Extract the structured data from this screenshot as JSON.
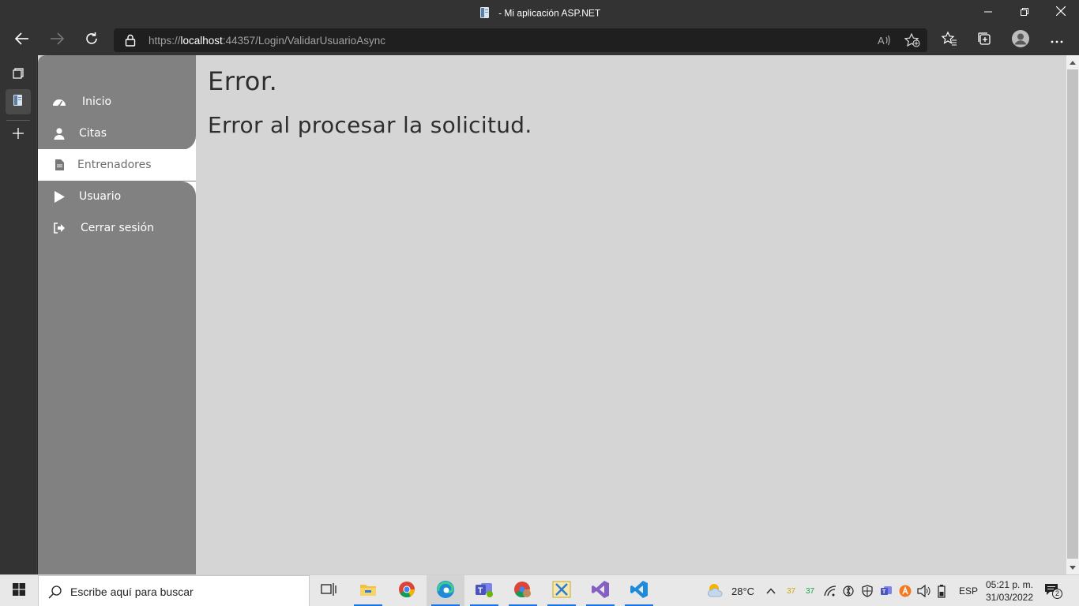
{
  "window": {
    "title": "- Mi aplicación ASP.NET",
    "minimize_icon": "minimize-icon",
    "restore_icon": "restore-icon",
    "close_icon": "close-icon"
  },
  "browser": {
    "url_prefix": "https://",
    "url_host": "localhost",
    "url_rest": ":44357/Login/ValidarUsuarioAsync",
    "read_aloud_label": "A",
    "icons": [
      "back-icon",
      "forward-icon",
      "refresh-icon",
      "lock-icon",
      "read-aloud-icon",
      "add-favorite-icon",
      "favorites-icon",
      "collections-icon",
      "profile-icon",
      "more-icon"
    ]
  },
  "sidebar": {
    "items": [
      {
        "label": "Inicio",
        "icon": "dashboard-icon"
      },
      {
        "label": "Citas",
        "icon": "user-icon"
      },
      {
        "label": "Entrenadores",
        "icon": "document-icon"
      },
      {
        "label": "Usuario",
        "icon": "play-icon"
      },
      {
        "label": "Cerrar sesión",
        "icon": "sign-out-icon"
      }
    ],
    "active_index": 2
  },
  "main": {
    "heading": "Error.",
    "message": "Error al procesar la solicitud."
  },
  "taskbar": {
    "search_placeholder": "Escribe aquí para buscar",
    "weather": "28°C",
    "tray_counter_1": "37",
    "tray_counter_2": "37",
    "language": "ESP",
    "time": "05:21 p. m.",
    "date": "31/03/2022",
    "notification_count": "2"
  },
  "colors": {
    "sidebar": "#818181",
    "page_bg": "#d5d5d5",
    "chrome_bg": "#333333",
    "taskbar_bg": "#e8e8e8",
    "active_indicator": "#1a73e8"
  }
}
